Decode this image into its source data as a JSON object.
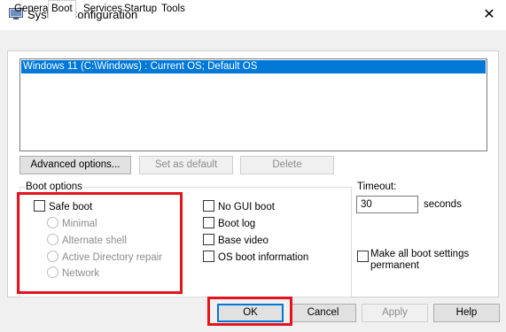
{
  "window": {
    "title": "System Configuration",
    "icon": "msconfig-icon",
    "close_glyph": "✕"
  },
  "tabs": [
    {
      "label": "General",
      "active": false
    },
    {
      "label": "Boot",
      "active": true
    },
    {
      "label": "Services",
      "active": false
    },
    {
      "label": "Startup",
      "active": false
    },
    {
      "label": "Tools",
      "active": false
    }
  ],
  "os_list": {
    "items": [
      "Windows 11 (C:\\Windows) : Current OS; Default OS"
    ],
    "selected_index": 0
  },
  "list_buttons": {
    "advanced": "Advanced options...",
    "set_default": "Set as default",
    "delete": "Delete"
  },
  "boot_options": {
    "group_label": "Boot options",
    "safe_boot": {
      "label": "Safe boot",
      "checked": false
    },
    "safe_modes": [
      "Minimal",
      "Alternate shell",
      "Active Directory repair",
      "Network"
    ],
    "no_gui": {
      "label": "No GUI boot",
      "checked": false
    },
    "boot_log": {
      "label": "Boot log",
      "checked": false
    },
    "base_video": {
      "label": "Base video",
      "checked": false
    },
    "os_info": {
      "label": "OS boot information",
      "checked": false
    }
  },
  "timeout": {
    "label": "Timeout:",
    "value": "30",
    "unit": "seconds"
  },
  "make_permanent": {
    "label": "Make all boot settings permanent",
    "checked": false
  },
  "footer": {
    "ok": "OK",
    "cancel": "Cancel",
    "apply": "Apply",
    "help": "Help"
  },
  "colors": {
    "selection": "#0078d7",
    "highlight": "#e3141c",
    "window_bg": "#f0f0f0"
  }
}
